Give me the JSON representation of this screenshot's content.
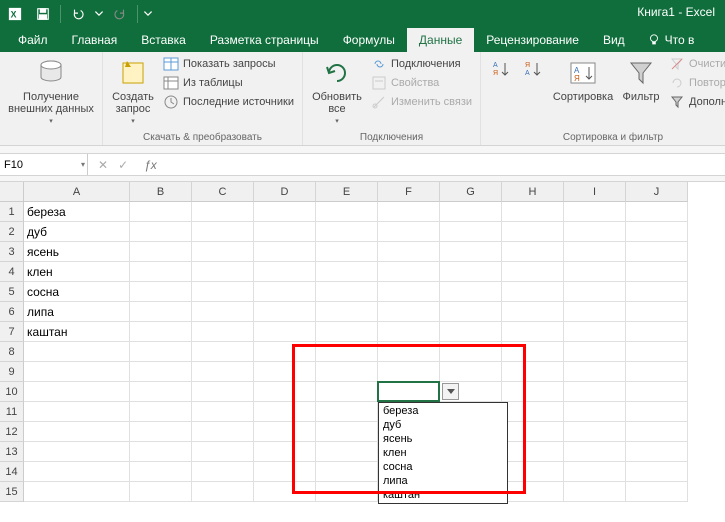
{
  "app_title": "Книга1 - Excel",
  "tabs": {
    "file": "Файл",
    "home": "Главная",
    "insert": "Вставка",
    "page_layout": "Разметка страницы",
    "formulas": "Формулы",
    "data": "Данные",
    "review": "Рецензирование",
    "view": "Вид"
  },
  "tell_me": "Что в",
  "ribbon": {
    "get_external": {
      "label": "Получение\nвнешних данных",
      "btn": ""
    },
    "transform": {
      "label": "Скачать & преобразовать",
      "new_query": "Создать\nзапрос",
      "show_queries": "Показать запросы",
      "from_table": "Из таблицы",
      "recent": "Последние источники"
    },
    "connections": {
      "label": "Подключения",
      "refresh": "Обновить\nвсе",
      "conns": "Подключения",
      "props": "Свойства",
      "edit_links": "Изменить связи"
    },
    "sort_filter": {
      "label": "Сортировка и фильтр",
      "sort": "Сортировка",
      "filter": "Фильтр",
      "clear": "Очистить",
      "reapply": "Повтори",
      "advanced": "Дополни"
    }
  },
  "name_box": "F10",
  "columns": [
    "A",
    "B",
    "C",
    "D",
    "E",
    "F",
    "G",
    "H",
    "I",
    "J"
  ],
  "rows": [
    1,
    2,
    3,
    4,
    5,
    6,
    7,
    8,
    9,
    10,
    11,
    12,
    13,
    14,
    15
  ],
  "cells": {
    "A1": "береза",
    "A2": "дуб",
    "A3": "ясень",
    "A4": "клен",
    "A5": "сосна",
    "A6": "липа",
    "A7": "каштан"
  },
  "dropdown_items": [
    "береза",
    "дуб",
    "ясень",
    "клен",
    "сосна",
    "липа",
    "каштан"
  ]
}
